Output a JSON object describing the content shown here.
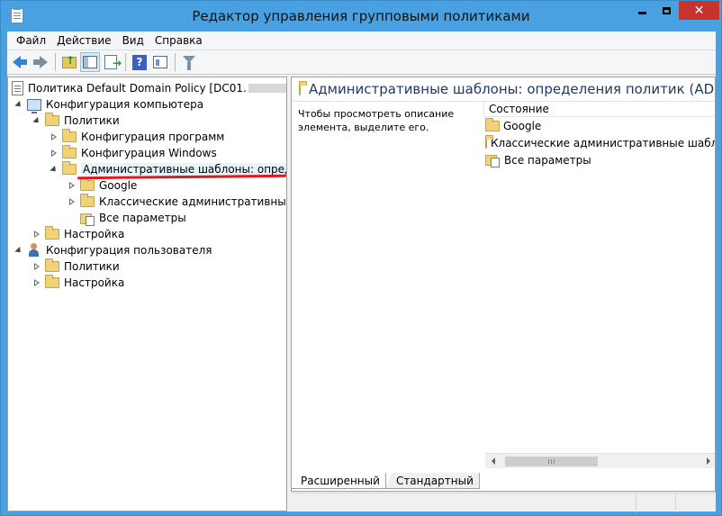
{
  "window": {
    "title": "Редактор управления групповыми политиками",
    "min_label": "",
    "max_label": "",
    "close_label": "✕"
  },
  "menu": [
    "Файл",
    "Действие",
    "Вид",
    "Справка"
  ],
  "toolbar": {
    "icons": [
      "back-arrow-icon",
      "forward-arrow-icon",
      "up-folder-icon",
      "show-hide-tree-icon",
      "export-list-icon",
      "help-icon",
      "properties-icon",
      "filter-icon"
    ]
  },
  "tree": {
    "root": {
      "label": "Политика Default Domain Policy [DC01."
    },
    "computer_config": {
      "label": "Конфигурация компьютера"
    },
    "policies": {
      "label": "Политики"
    },
    "software_config": {
      "label": "Конфигурация программ"
    },
    "windows_config": {
      "label": "Конфигурация Windows"
    },
    "admin_templates": {
      "label": "Административные шаблоны: определе"
    },
    "google": {
      "label": "Google"
    },
    "classic_templates": {
      "label": "Классические административные шаб"
    },
    "all_settings": {
      "label": "Все параметры"
    },
    "settings": {
      "label": "Настройка"
    },
    "user_config": {
      "label": "Конфигурация пользователя"
    },
    "user_policies": {
      "label": "Политики"
    },
    "user_settings": {
      "label": "Настройка"
    }
  },
  "right": {
    "header_title": "Административные шаблоны: определения политик (ADMX-ф",
    "description": "Чтобы просмотреть описание элемента, выделите его.",
    "column_header": "Состояние",
    "items": [
      {
        "label": "Google"
      },
      {
        "label": "Классические административные шаблоны"
      },
      {
        "label": "Все параметры"
      }
    ]
  },
  "tabs": {
    "extended": "Расширенный",
    "standard": "Стандартный"
  },
  "colors": {
    "titlebar": "#4aa1e1",
    "close": "#c7342e",
    "annotation": "#e0191d"
  }
}
